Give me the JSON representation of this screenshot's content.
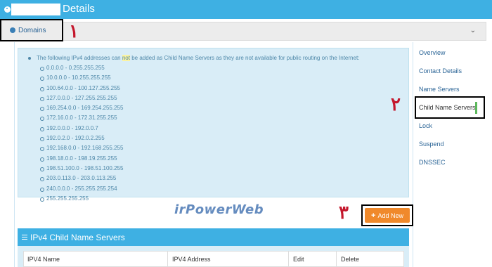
{
  "header": {
    "title": "Details"
  },
  "domains": {
    "label": "Domains",
    "chevron": "chevron-down-icon"
  },
  "markers": {
    "m1": "١",
    "m2": "٢",
    "m3": "٣"
  },
  "alert": {
    "before": "The following IPv4 addresses can ",
    "highlight": "not",
    "after": " be added as Child Name Servers as they are not available for public routing on the Internet:",
    "ranges": [
      "0.0.0.0 - 0.255.255.255",
      "10.0.0.0 - 10.255.255.255",
      "100.64.0.0 - 100.127.255.255",
      "127.0.0.0 - 127.255.255.255",
      "169.254.0.0 - 169.254.255.255",
      "172.16.0.0 - 172.31.255.255",
      "192.0.0.0 - 192.0.0.7",
      "192.0.2.0 - 192.0.2.255",
      "192.168.0.0 - 192.168.255.255",
      "198.18.0.0 - 198.19.255.255",
      "198.51.100.0 - 198.51.100.255",
      "203.0.113.0 - 203.0.113.255",
      "240.0.0.0 - 255.255.255.254",
      "255.255.255.255"
    ]
  },
  "nav": {
    "overview": "Overview",
    "contact": "Contact Details",
    "nameservers": "Name Servers",
    "child": "Child Name Servers",
    "lock": "Lock",
    "suspend": "Suspend",
    "dnssec": "DNSSEC"
  },
  "watermark": "irPowerWeb",
  "add_new": "Add New",
  "panel": {
    "title": "IPv4 Child Name Servers",
    "columns": [
      "IPV4 Name",
      "IPV4 Address",
      "Edit",
      "Delete"
    ]
  },
  "colors": {
    "accent": "#3eb0e3",
    "alert_bg": "#d9edf7",
    "button": "#f0892b",
    "marker": "#c4172c",
    "active_bar": "#5cb85c"
  }
}
